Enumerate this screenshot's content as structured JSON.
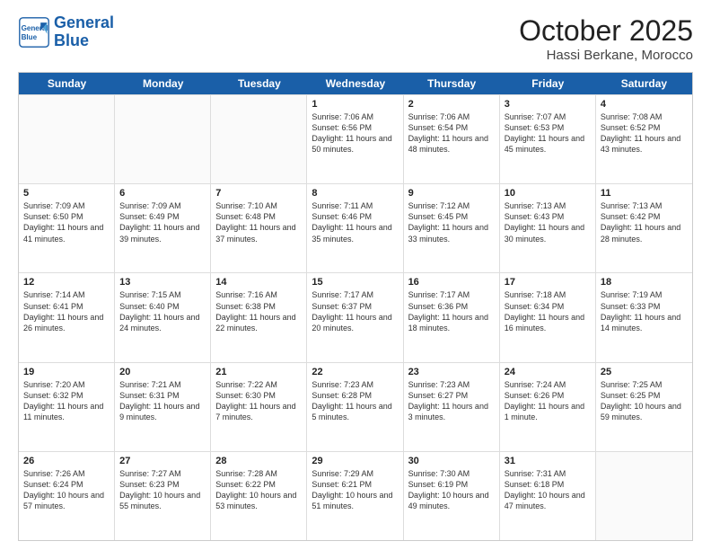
{
  "header": {
    "logo_line1": "General",
    "logo_line2": "Blue",
    "month_title": "October 2025",
    "location": "Hassi Berkane, Morocco"
  },
  "days_of_week": [
    "Sunday",
    "Monday",
    "Tuesday",
    "Wednesday",
    "Thursday",
    "Friday",
    "Saturday"
  ],
  "weeks": [
    [
      {
        "day": "",
        "info": ""
      },
      {
        "day": "",
        "info": ""
      },
      {
        "day": "",
        "info": ""
      },
      {
        "day": "1",
        "info": "Sunrise: 7:06 AM\nSunset: 6:56 PM\nDaylight: 11 hours\nand 50 minutes."
      },
      {
        "day": "2",
        "info": "Sunrise: 7:06 AM\nSunset: 6:54 PM\nDaylight: 11 hours\nand 48 minutes."
      },
      {
        "day": "3",
        "info": "Sunrise: 7:07 AM\nSunset: 6:53 PM\nDaylight: 11 hours\nand 45 minutes."
      },
      {
        "day": "4",
        "info": "Sunrise: 7:08 AM\nSunset: 6:52 PM\nDaylight: 11 hours\nand 43 minutes."
      }
    ],
    [
      {
        "day": "5",
        "info": "Sunrise: 7:09 AM\nSunset: 6:50 PM\nDaylight: 11 hours\nand 41 minutes."
      },
      {
        "day": "6",
        "info": "Sunrise: 7:09 AM\nSunset: 6:49 PM\nDaylight: 11 hours\nand 39 minutes."
      },
      {
        "day": "7",
        "info": "Sunrise: 7:10 AM\nSunset: 6:48 PM\nDaylight: 11 hours\nand 37 minutes."
      },
      {
        "day": "8",
        "info": "Sunrise: 7:11 AM\nSunset: 6:46 PM\nDaylight: 11 hours\nand 35 minutes."
      },
      {
        "day": "9",
        "info": "Sunrise: 7:12 AM\nSunset: 6:45 PM\nDaylight: 11 hours\nand 33 minutes."
      },
      {
        "day": "10",
        "info": "Sunrise: 7:13 AM\nSunset: 6:43 PM\nDaylight: 11 hours\nand 30 minutes."
      },
      {
        "day": "11",
        "info": "Sunrise: 7:13 AM\nSunset: 6:42 PM\nDaylight: 11 hours\nand 28 minutes."
      }
    ],
    [
      {
        "day": "12",
        "info": "Sunrise: 7:14 AM\nSunset: 6:41 PM\nDaylight: 11 hours\nand 26 minutes."
      },
      {
        "day": "13",
        "info": "Sunrise: 7:15 AM\nSunset: 6:40 PM\nDaylight: 11 hours\nand 24 minutes."
      },
      {
        "day": "14",
        "info": "Sunrise: 7:16 AM\nSunset: 6:38 PM\nDaylight: 11 hours\nand 22 minutes."
      },
      {
        "day": "15",
        "info": "Sunrise: 7:17 AM\nSunset: 6:37 PM\nDaylight: 11 hours\nand 20 minutes."
      },
      {
        "day": "16",
        "info": "Sunrise: 7:17 AM\nSunset: 6:36 PM\nDaylight: 11 hours\nand 18 minutes."
      },
      {
        "day": "17",
        "info": "Sunrise: 7:18 AM\nSunset: 6:34 PM\nDaylight: 11 hours\nand 16 minutes."
      },
      {
        "day": "18",
        "info": "Sunrise: 7:19 AM\nSunset: 6:33 PM\nDaylight: 11 hours\nand 14 minutes."
      }
    ],
    [
      {
        "day": "19",
        "info": "Sunrise: 7:20 AM\nSunset: 6:32 PM\nDaylight: 11 hours\nand 11 minutes."
      },
      {
        "day": "20",
        "info": "Sunrise: 7:21 AM\nSunset: 6:31 PM\nDaylight: 11 hours\nand 9 minutes."
      },
      {
        "day": "21",
        "info": "Sunrise: 7:22 AM\nSunset: 6:30 PM\nDaylight: 11 hours\nand 7 minutes."
      },
      {
        "day": "22",
        "info": "Sunrise: 7:23 AM\nSunset: 6:28 PM\nDaylight: 11 hours\nand 5 minutes."
      },
      {
        "day": "23",
        "info": "Sunrise: 7:23 AM\nSunset: 6:27 PM\nDaylight: 11 hours\nand 3 minutes."
      },
      {
        "day": "24",
        "info": "Sunrise: 7:24 AM\nSunset: 6:26 PM\nDaylight: 11 hours\nand 1 minute."
      },
      {
        "day": "25",
        "info": "Sunrise: 7:25 AM\nSunset: 6:25 PM\nDaylight: 10 hours\nand 59 minutes."
      }
    ],
    [
      {
        "day": "26",
        "info": "Sunrise: 7:26 AM\nSunset: 6:24 PM\nDaylight: 10 hours\nand 57 minutes."
      },
      {
        "day": "27",
        "info": "Sunrise: 7:27 AM\nSunset: 6:23 PM\nDaylight: 10 hours\nand 55 minutes."
      },
      {
        "day": "28",
        "info": "Sunrise: 7:28 AM\nSunset: 6:22 PM\nDaylight: 10 hours\nand 53 minutes."
      },
      {
        "day": "29",
        "info": "Sunrise: 7:29 AM\nSunset: 6:21 PM\nDaylight: 10 hours\nand 51 minutes."
      },
      {
        "day": "30",
        "info": "Sunrise: 7:30 AM\nSunset: 6:19 PM\nDaylight: 10 hours\nand 49 minutes."
      },
      {
        "day": "31",
        "info": "Sunrise: 7:31 AM\nSunset: 6:18 PM\nDaylight: 10 hours\nand 47 minutes."
      },
      {
        "day": "",
        "info": ""
      }
    ]
  ]
}
